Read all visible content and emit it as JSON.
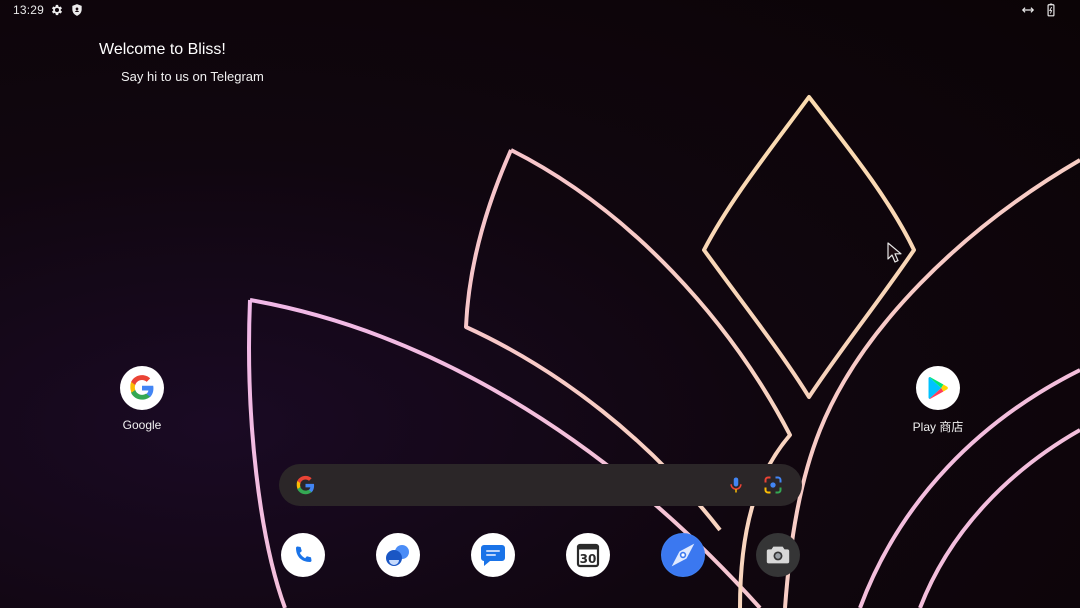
{
  "status_bar": {
    "time": "13:29",
    "left_icons": [
      "settings-gear-icon",
      "shield-icon"
    ],
    "right_icons": [
      "link-arrows-icon",
      "battery-icon"
    ]
  },
  "welcome_widget": {
    "title": "Welcome to Bliss!",
    "subtitle": "Say hi to us on Telegram"
  },
  "desktop_apps": [
    {
      "name": "google",
      "label": "Google",
      "icon": "google-g-icon"
    },
    {
      "name": "play-store",
      "label": "Play 商店",
      "icon": "play-store-icon"
    }
  ],
  "search_bar": {
    "icons": [
      "google-g-icon",
      "microphone-icon",
      "google-lens-icon"
    ]
  },
  "dock": [
    {
      "name": "phone",
      "icon": "phone-icon"
    },
    {
      "name": "contacts",
      "icon": "contacts-icon"
    },
    {
      "name": "messages",
      "icon": "messages-icon"
    },
    {
      "name": "calendar",
      "icon": "calendar-icon",
      "day": "30"
    },
    {
      "name": "maps-compass",
      "icon": "compass-icon"
    },
    {
      "name": "camera",
      "icon": "camera-icon"
    }
  ],
  "colors": {
    "background": "#0c0508",
    "petal_pink": "#f2c1de",
    "petal_peach": "#f7d0c4",
    "petal_cream": "#fbdcb3",
    "search_bar": "#2b2628"
  }
}
